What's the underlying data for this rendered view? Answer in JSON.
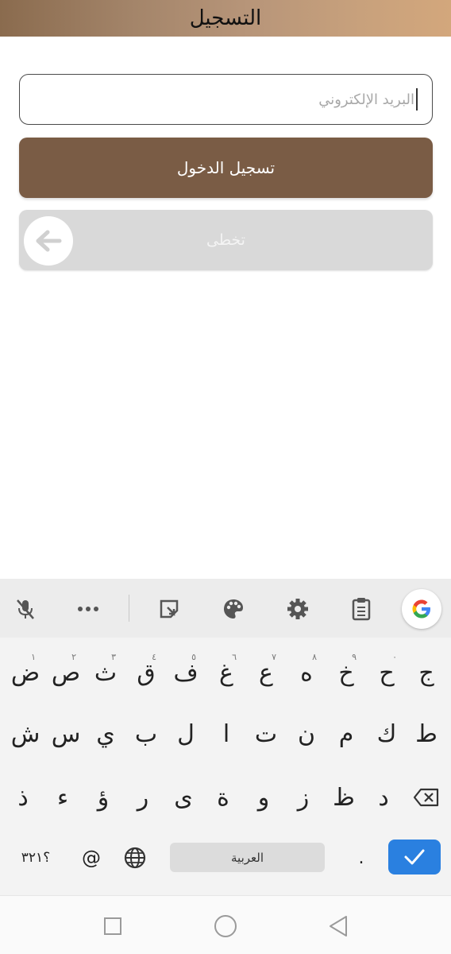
{
  "header": {
    "title": "التسجيل"
  },
  "form": {
    "email_placeholder": "البريد الإلكتروني",
    "login_label": "تسجيل الدخول",
    "skip_label": "تخطى"
  },
  "colors": {
    "accent_brown": "#7a5c45",
    "skip_gray": "#d9d9d9",
    "enter_blue": "#2a80e0"
  },
  "keyboard": {
    "toolbar_icons": [
      "mic-off-icon",
      "more-icon",
      "sticker-icon",
      "palette-icon",
      "settings-icon",
      "clipboard-icon",
      "google-logo"
    ],
    "row1": [
      {
        "char": "ض",
        "hint": "١"
      },
      {
        "char": "ص",
        "hint": "٢"
      },
      {
        "char": "ث",
        "hint": "٣"
      },
      {
        "char": "ق",
        "hint": "٤"
      },
      {
        "char": "ف",
        "hint": "٥"
      },
      {
        "char": "غ",
        "hint": "٦"
      },
      {
        "char": "ع",
        "hint": "٧"
      },
      {
        "char": "ه",
        "hint": "٨"
      },
      {
        "char": "خ",
        "hint": "٩"
      },
      {
        "char": "ح",
        "hint": "٠"
      },
      {
        "char": "ج",
        "hint": ""
      }
    ],
    "row2": [
      "ش",
      "س",
      "ي",
      "ب",
      "ل",
      "ا",
      "ت",
      "ن",
      "م",
      "ك",
      "ط"
    ],
    "row3": [
      "ذ",
      "ء",
      "ؤ",
      "ر",
      "ى",
      "ة",
      "و",
      "ز",
      "ظ",
      "د"
    ],
    "symbols_label": "؟٣٢١",
    "at_label": "@",
    "space_label": "العربية",
    "period_label": "."
  }
}
